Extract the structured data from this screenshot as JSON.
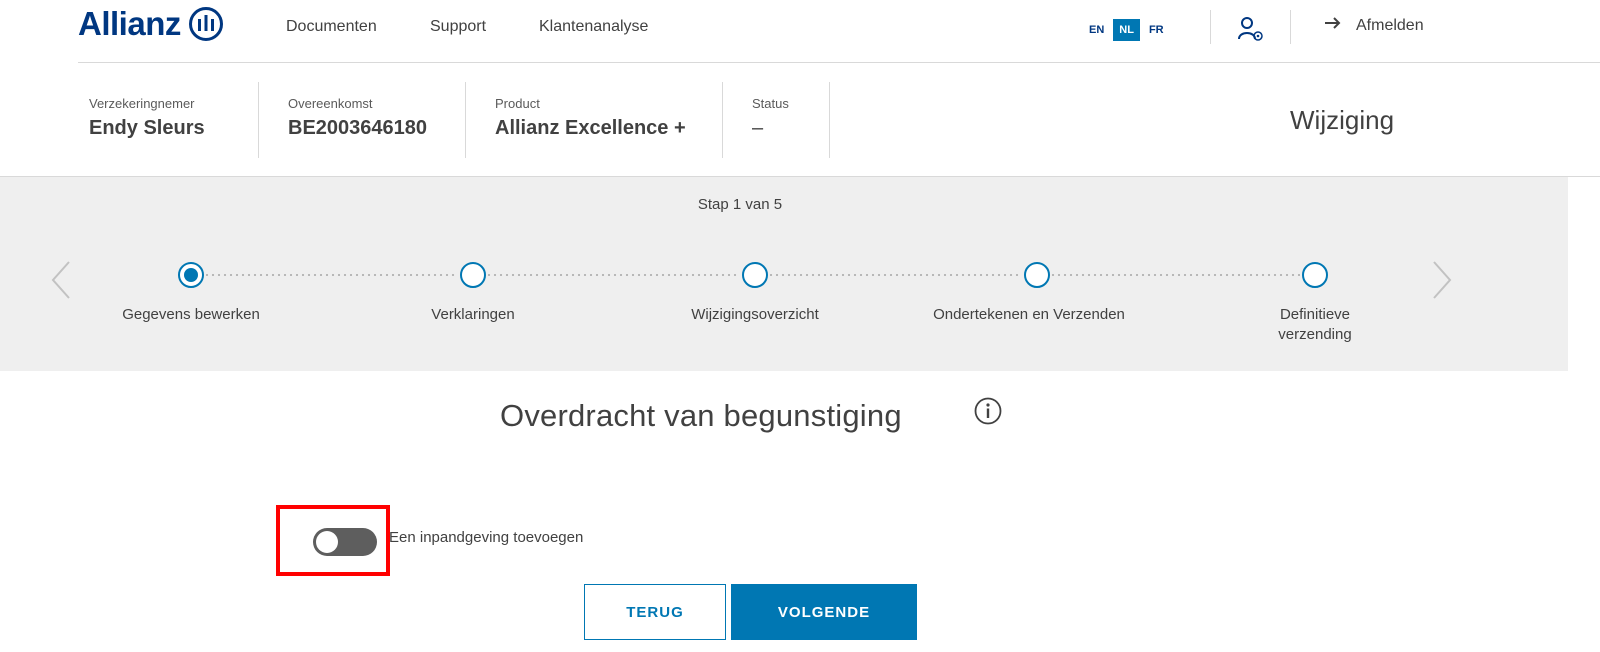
{
  "header": {
    "logo_text": "Allianz",
    "nav": [
      "Documenten",
      "Support",
      "Klantenanalyse"
    ],
    "languages": [
      "EN",
      "NL",
      "FR"
    ],
    "active_language": "NL",
    "logout_label": "Afmelden",
    "icons": {
      "user": "user-settings-icon",
      "logout": "arrow-right-icon",
      "logo": "allianz-eagle-logo"
    }
  },
  "policy": {
    "holder_label": "Verzekeringnemer",
    "holder_value": "Endy Sleurs",
    "agreement_label": "Overeenkomst",
    "agreement_value": "BE2003646180",
    "product_label": "Product",
    "product_value": "Allianz Excellence +",
    "status_label": "Status",
    "status_value": "–",
    "mode_title": "Wijziging"
  },
  "stepper": {
    "caption": "Stap 1 van 5",
    "current_step": 1,
    "total_steps": 5,
    "steps": [
      {
        "label": "Gegevens bewerken"
      },
      {
        "label": "Verklaringen"
      },
      {
        "label": "Wijzigingsoverzicht"
      },
      {
        "label": "Ondertekenen en Verzenden"
      },
      {
        "label_line1": "Definitieve",
        "label_line2": "verzending"
      }
    ],
    "icons": {
      "prev": "chevron-left-icon",
      "next": "chevron-right-icon"
    }
  },
  "content": {
    "title": "Overdracht van begunstiging",
    "title_icon": "info-icon",
    "pledge_toggle_label": "Een inpandgeving toevoegen",
    "pledge_toggle_on": false
  },
  "actions": {
    "back_label": "TERUG",
    "next_label": "VOLGENDE"
  },
  "colors": {
    "brand": "#003781",
    "accent": "#0077b3",
    "panel": "#efefef",
    "highlight": "#ff0000"
  }
}
